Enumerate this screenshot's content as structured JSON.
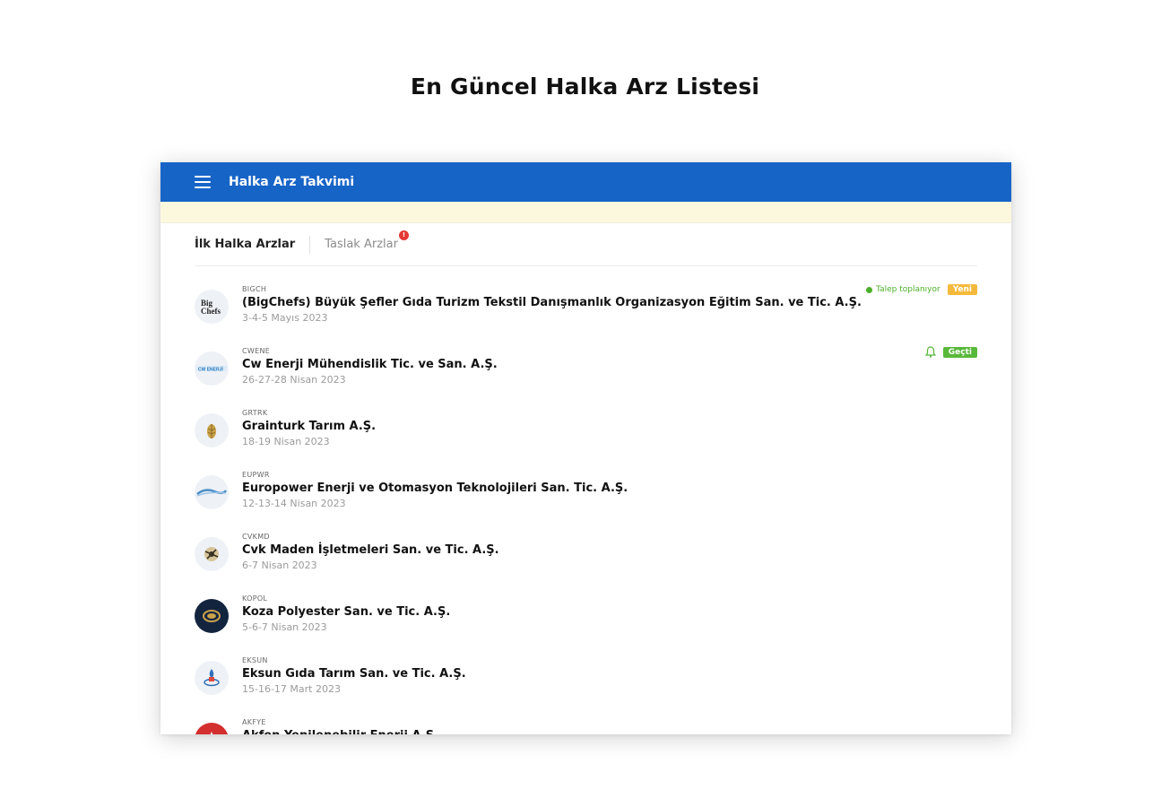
{
  "page": {
    "title": "En Güncel Halka Arz Listesi"
  },
  "appbar": {
    "title": "Halka Arz Takvimi"
  },
  "tabs": [
    {
      "label": "İlk Halka Arzlar"
    },
    {
      "label": "Taslak Arzlar",
      "badge": "!"
    }
  ],
  "status": {
    "collecting": "Talep toplanıyor",
    "new_badge": "Yeni",
    "past_badge": "Geçti"
  },
  "colors": {
    "appbar": "#1764c7",
    "status_green": "#4caf2a",
    "badge_new": "#f5b93c",
    "badge_past": "#58b83a",
    "notice": "#fcf8de"
  },
  "ipos": [
    {
      "code": "BIGCH",
      "name": "(BigChefs) Büyük Şefler Gıda Turizm Tekstil Danışmanlık Organizasyon Eğitim San. ve Tic. A.Ş.",
      "date": "3-4-5 Mayıs 2023",
      "logo_text": "Big Chefs"
    },
    {
      "code": "CWENE",
      "name": "Cw Enerji Mühendislik Tic. ve San. A.Ş.",
      "date": "26-27-28 Nisan 2023",
      "logo_text": "CW ENERJİ"
    },
    {
      "code": "GRTRK",
      "name": "Grainturk Tarım A.Ş.",
      "date": "18-19 Nisan 2023"
    },
    {
      "code": "EUPWR",
      "name": "Europower Enerji ve Otomasyon Teknolojileri San. Tic. A.Ş.",
      "date": "12-13-14 Nisan 2023"
    },
    {
      "code": "CVKMD",
      "name": "Cvk Maden İşletmeleri San. ve Tic. A.Ş.",
      "date": "6-7 Nisan 2023"
    },
    {
      "code": "KOPOL",
      "name": "Koza Polyester San. ve Tic. A.Ş.",
      "date": "5-6-7 Nisan 2023"
    },
    {
      "code": "EKSUN",
      "name": "Eksun Gıda Tarım San. ve Tic. A.Ş.",
      "date": "15-16-17 Mart 2023"
    },
    {
      "code": "AKFYE",
      "name": "Akfen Yenilenebilir Enerji A.Ş.",
      "date": ""
    }
  ]
}
